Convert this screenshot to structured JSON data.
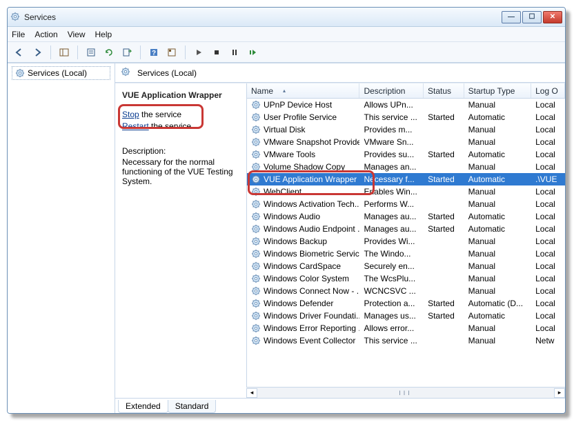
{
  "window": {
    "title": "Services"
  },
  "menu": {
    "file": "File",
    "action": "Action",
    "view": "View",
    "help": "Help"
  },
  "left": {
    "node": "Services (Local)"
  },
  "header": {
    "title": "Services (Local)"
  },
  "detail": {
    "title": "VUE Application Wrapper",
    "stop_link": "Stop",
    "stop_suffix": " the service",
    "restart_link": "Restart",
    "restart_suffix": " the service",
    "desc_label": "Description:",
    "desc_text": "Necessary for the normal functioning of the VUE Testing System."
  },
  "columns": {
    "name": "Name",
    "description": "Description",
    "status": "Status",
    "startup": "Startup Type",
    "logon": "Log O"
  },
  "tabs": {
    "extended": "Extended",
    "standard": "Standard"
  },
  "services": [
    {
      "name": "UPnP Device Host",
      "desc": "Allows UPn...",
      "status": "",
      "startup": "Manual",
      "logon": "Local"
    },
    {
      "name": "User Profile Service",
      "desc": "This service ...",
      "status": "Started",
      "startup": "Automatic",
      "logon": "Local"
    },
    {
      "name": "Virtual Disk",
      "desc": "Provides m...",
      "status": "",
      "startup": "Manual",
      "logon": "Local"
    },
    {
      "name": "VMware Snapshot Provider",
      "desc": "VMware Sn...",
      "status": "",
      "startup": "Manual",
      "logon": "Local"
    },
    {
      "name": "VMware Tools",
      "desc": "Provides su...",
      "status": "Started",
      "startup": "Automatic",
      "logon": "Local"
    },
    {
      "name": "Volume Shadow Copy",
      "desc": "Manages an...",
      "status": "",
      "startup": "Manual",
      "logon": "Local"
    },
    {
      "name": "VUE Application Wrapper",
      "desc": "Necessary f...",
      "status": "Started",
      "startup": "Automatic",
      "logon": ".\\VUE",
      "selected": true
    },
    {
      "name": "WebClient",
      "desc": "Enables Win...",
      "status": "",
      "startup": "Manual",
      "logon": "Local"
    },
    {
      "name": "Windows Activation Tech...",
      "desc": "Performs W...",
      "status": "",
      "startup": "Manual",
      "logon": "Local"
    },
    {
      "name": "Windows Audio",
      "desc": "Manages au...",
      "status": "Started",
      "startup": "Automatic",
      "logon": "Local"
    },
    {
      "name": "Windows Audio Endpoint ...",
      "desc": "Manages au...",
      "status": "Started",
      "startup": "Automatic",
      "logon": "Local"
    },
    {
      "name": "Windows Backup",
      "desc": "Provides Wi...",
      "status": "",
      "startup": "Manual",
      "logon": "Local"
    },
    {
      "name": "Windows Biometric Service",
      "desc": "The Windo...",
      "status": "",
      "startup": "Manual",
      "logon": "Local"
    },
    {
      "name": "Windows CardSpace",
      "desc": "Securely en...",
      "status": "",
      "startup": "Manual",
      "logon": "Local"
    },
    {
      "name": "Windows Color System",
      "desc": "The WcsPlu...",
      "status": "",
      "startup": "Manual",
      "logon": "Local"
    },
    {
      "name": "Windows Connect Now - ...",
      "desc": "WCNCSVC ...",
      "status": "",
      "startup": "Manual",
      "logon": "Local"
    },
    {
      "name": "Windows Defender",
      "desc": "Protection a...",
      "status": "Started",
      "startup": "Automatic (D...",
      "logon": "Local"
    },
    {
      "name": "Windows Driver Foundati...",
      "desc": "Manages us...",
      "status": "Started",
      "startup": "Automatic",
      "logon": "Local"
    },
    {
      "name": "Windows Error Reporting ...",
      "desc": "Allows error...",
      "status": "",
      "startup": "Manual",
      "logon": "Local"
    },
    {
      "name": "Windows Event Collector",
      "desc": "This service ...",
      "status": "",
      "startup": "Manual",
      "logon": "Netw"
    }
  ]
}
